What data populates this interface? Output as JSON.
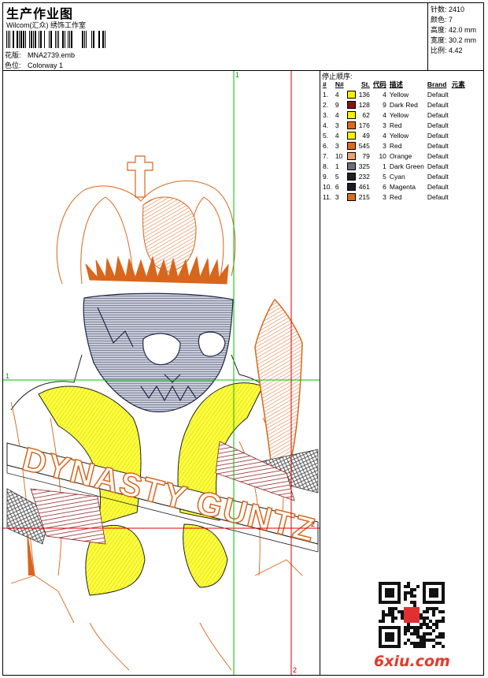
{
  "header": {
    "title": "生产作业图",
    "subtitle": "Wilcom(汇众) 绣饰工作室",
    "design_label": "花版:",
    "design_name": "MNA2739.emb",
    "colorway_label": "色位:",
    "colorway_name": "Colorway 1"
  },
  "stats": [
    {
      "label": "针数:",
      "value": "2410"
    },
    {
      "label": "颜色:",
      "value": "7"
    },
    {
      "label": "高度:",
      "value": "42.0 mm"
    },
    {
      "label": "宽度:",
      "value": "30.2 mm"
    },
    {
      "label": "比例:",
      "value": "4.42"
    }
  ],
  "stop_sequence": {
    "title": "停止顺序:",
    "headers": [
      "#",
      "N#",
      "St.",
      "代码",
      "描述",
      "Brand",
      "元素"
    ],
    "rows": [
      {
        "idx": "1.",
        "n": "4",
        "color": "#f7f000",
        "st": "136",
        "code": "4",
        "desc": "Yellow",
        "brand": "Default"
      },
      {
        "idx": "2.",
        "n": "9",
        "color": "#8b1010",
        "st": "128",
        "code": "9",
        "desc": "Dark Red",
        "brand": "Default"
      },
      {
        "idx": "3.",
        "n": "4",
        "color": "#f7f000",
        "st": "62",
        "code": "4",
        "desc": "Yellow",
        "brand": "Default"
      },
      {
        "idx": "4.",
        "n": "3",
        "color": "#e06a1c",
        "st": "176",
        "code": "3",
        "desc": "Red",
        "brand": "Default"
      },
      {
        "idx": "5.",
        "n": "4",
        "color": "#f7f000",
        "st": "49",
        "code": "4",
        "desc": "Yellow",
        "brand": "Default"
      },
      {
        "idx": "6.",
        "n": "3",
        "color": "#e06a1c",
        "st": "545",
        "code": "3",
        "desc": "Red",
        "brand": "Default"
      },
      {
        "idx": "7.",
        "n": "10",
        "color": "#f0a070",
        "st": "79",
        "code": "10",
        "desc": "Orange",
        "brand": "Default"
      },
      {
        "idx": "8.",
        "n": "1",
        "color": "#6a6f80",
        "st": "325",
        "code": "1",
        "desc": "Dark Green",
        "brand": "Default"
      },
      {
        "idx": "9.",
        "n": "5",
        "color": "#202020",
        "st": "232",
        "code": "5",
        "desc": "Cyan",
        "brand": "Default"
      },
      {
        "idx": "10.",
        "n": "6",
        "color": "#1a1a2a",
        "st": "461",
        "code": "6",
        "desc": "Magenta",
        "brand": "Default"
      },
      {
        "idx": "11.",
        "n": "3",
        "color": "#e06a1c",
        "st": "215",
        "code": "3",
        "desc": "Red",
        "brand": "Default"
      }
    ]
  },
  "guides": {
    "green_1": "1",
    "red_2": "2"
  },
  "design_text": "DYNASTY GUNTZ",
  "watermark": "6xiu.com",
  "colors": {
    "green": "#00c000",
    "red": "#e00000",
    "orange": "#d8661c",
    "yellow": "#ffff20",
    "darkred": "#8a1a1a",
    "navy": "#202848"
  }
}
